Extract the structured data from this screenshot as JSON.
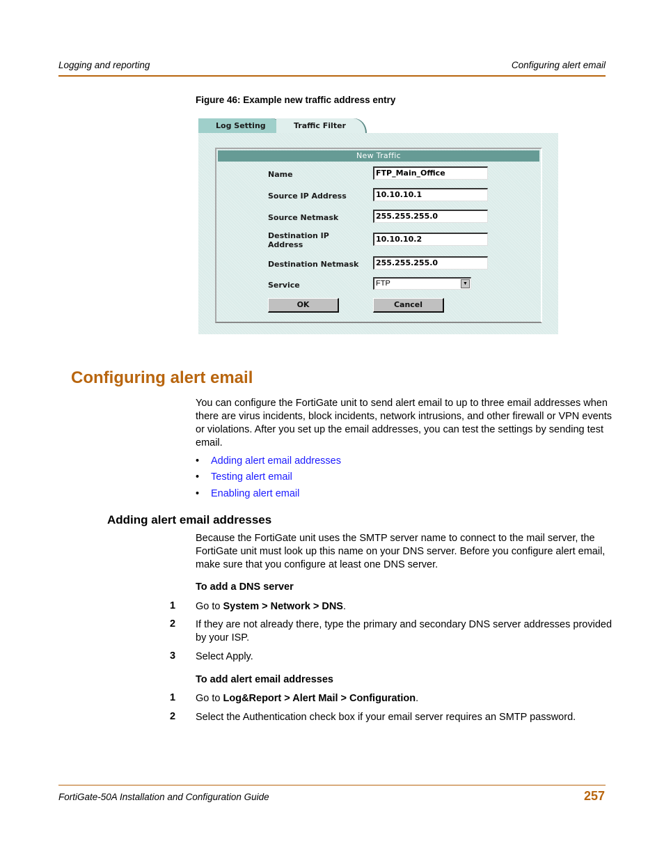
{
  "header": {
    "left": "Logging and reporting",
    "right": "Configuring alert email"
  },
  "figure": {
    "caption": "Figure 46: Example new traffic address entry",
    "tabs": [
      {
        "label": "Log Setting",
        "active": false
      },
      {
        "label": "Traffic Filter",
        "active": true
      }
    ],
    "panel_title": "New Traffic",
    "fields": [
      {
        "label": "Name",
        "value": "FTP_Main_Office"
      },
      {
        "label": "Source IP Address",
        "value": "10.10.10.1"
      },
      {
        "label": "Source Netmask",
        "value": "255.255.255.0"
      },
      {
        "label": "Destination IP Address",
        "value": "10.10.10.2"
      },
      {
        "label": "Destination Netmask",
        "value": "255.255.255.0"
      }
    ],
    "service": {
      "label": "Service",
      "selected": "FTP"
    },
    "buttons": {
      "ok": "OK",
      "cancel": "Cancel"
    }
  },
  "section": {
    "title": "Configuring alert email",
    "intro": "You can configure the FortiGate unit to send alert email to up to three email addresses when there are virus incidents, block incidents, network intrusions, and other firewall or VPN events or violations. After you set up the email addresses, you can test the settings by sending test email.",
    "links": [
      "Adding alert email addresses",
      "Testing alert email",
      "Enabling alert email"
    ],
    "bullet": "•"
  },
  "subsection": {
    "title": "Adding alert email addresses",
    "intro": "Because the FortiGate unit uses the SMTP server name to connect to the mail server, the FortiGate unit must look up this name on your DNS server. Before you configure alert email, make sure that you configure at least one DNS server.",
    "procedures": [
      {
        "title": "To add a DNS server",
        "steps": [
          {
            "num": "1",
            "pre": "Go to ",
            "bold": "System > Network > DNS",
            "post": "."
          },
          {
            "num": "2",
            "pre": "If they are not already there, type the primary and secondary DNS server addresses provided by your ISP.",
            "bold": "",
            "post": ""
          },
          {
            "num": "3",
            "pre": "Select Apply.",
            "bold": "",
            "post": ""
          }
        ]
      },
      {
        "title": "To add alert email addresses",
        "steps": [
          {
            "num": "1",
            "pre": "Go to ",
            "bold": "Log&Report > Alert Mail > Configuration",
            "post": "."
          },
          {
            "num": "2",
            "pre": "Select the Authentication check box if your email server requires an SMTP password.",
            "bold": "",
            "post": ""
          }
        ]
      }
    ]
  },
  "footer": {
    "guide": "FortiGate-50A Installation and Configuration Guide",
    "page": "257"
  },
  "colors": {
    "accent": "#b8650e",
    "link": "#1a1aff",
    "panel_header": "#669b95"
  }
}
